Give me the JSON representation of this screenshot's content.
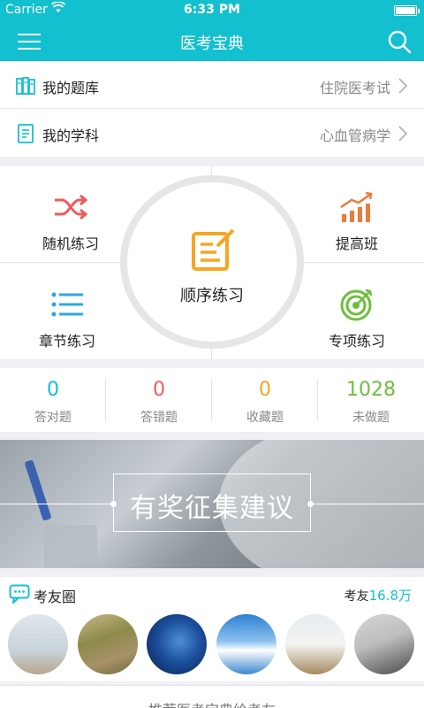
{
  "status_bar": {
    "carrier": "Carrier",
    "time": "6:33 PM"
  },
  "nav": {
    "title": "医考宝典",
    "menu_icon": "hamburger-menu-icon",
    "search_icon": "search-icon"
  },
  "rows": [
    {
      "label": "我的题库",
      "value": "住院医考试",
      "icon": "book-library-icon"
    },
    {
      "label": "我的学科",
      "value": "心血管病学",
      "icon": "subject-document-icon"
    }
  ],
  "practice": {
    "random": {
      "label": "随机练习",
      "icon": "shuffle-icon"
    },
    "improve": {
      "label": "提高班",
      "icon": "bar-chart-trend-icon"
    },
    "sequence": {
      "label": "顺序练习",
      "icon": "edit-note-icon"
    },
    "chapter": {
      "label": "章节练习",
      "icon": "list-icon"
    },
    "special": {
      "label": "专项练习",
      "icon": "target-icon"
    }
  },
  "stats": [
    {
      "value": "0",
      "label": "答对题",
      "color": "#13c0cf"
    },
    {
      "value": "0",
      "label": "答错题",
      "color": "#f05a5a"
    },
    {
      "value": "0",
      "label": "收藏题",
      "color": "#f5a623"
    },
    {
      "value": "1028",
      "label": "未做题",
      "color": "#6cbf3c"
    }
  ],
  "banner": {
    "text": "有奖征集建议"
  },
  "circle": {
    "title": "考友圈",
    "friends_label": "考友",
    "friends_count": "16.8万",
    "icon": "chat-bubble-icon"
  },
  "footer": {
    "text": "推荐医考宝典给考友"
  },
  "colors": {
    "primary": "#13c0cf",
    "orange": "#f5a623",
    "red": "#f05a5a",
    "green": "#6cbf3c",
    "blue": "#2ca6e6"
  }
}
